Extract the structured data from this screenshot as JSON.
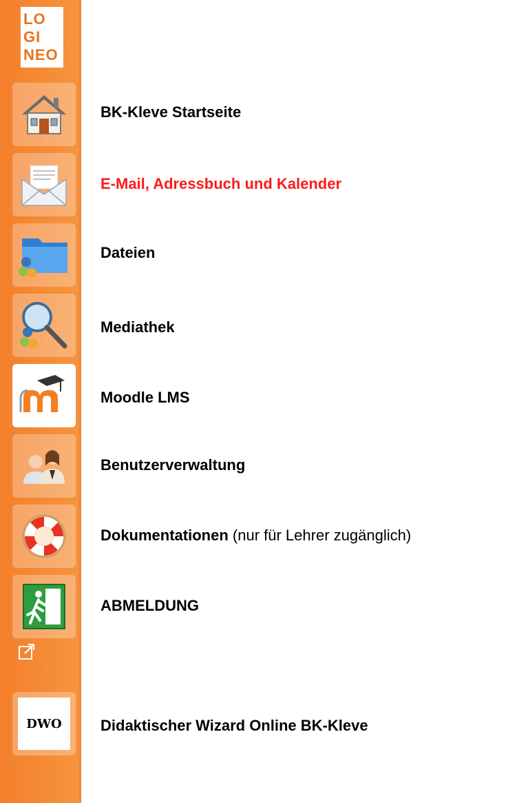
{
  "sidebar": {
    "logo_lines": [
      "LO",
      "GI",
      "NEO"
    ],
    "items": [
      {
        "name": "home",
        "label": "BK-Kleve Startseite",
        "icon": "house-icon"
      },
      {
        "name": "email",
        "label": "E-Mail, Adressbuch und Kalender",
        "icon": "envelope-icon"
      },
      {
        "name": "files",
        "label": "Dateien",
        "icon": "folder-icon"
      },
      {
        "name": "mediathek",
        "label": "Mediathek",
        "icon": "magnifier-icon"
      },
      {
        "name": "moodle",
        "label": "Moodle LMS",
        "icon": "moodle-icon"
      },
      {
        "name": "users",
        "label": "Benutzerverwaltung",
        "icon": "users-icon"
      },
      {
        "name": "docs",
        "label": "Dokumentationen",
        "note": " (nur für Lehrer zugänglich)",
        "icon": "lifebuoy-icon"
      },
      {
        "name": "logout",
        "label": "ABMELDUNG",
        "icon": "exit-icon"
      },
      {
        "name": "dwo",
        "label": "Didaktischer Wizard Online BK-Kleve",
        "icon": "dwo-icon",
        "icon_text": "DWO"
      }
    ]
  },
  "colors": {
    "sidebar_orange": "#f47f2b",
    "highlight_red": "#ff1a1a"
  }
}
